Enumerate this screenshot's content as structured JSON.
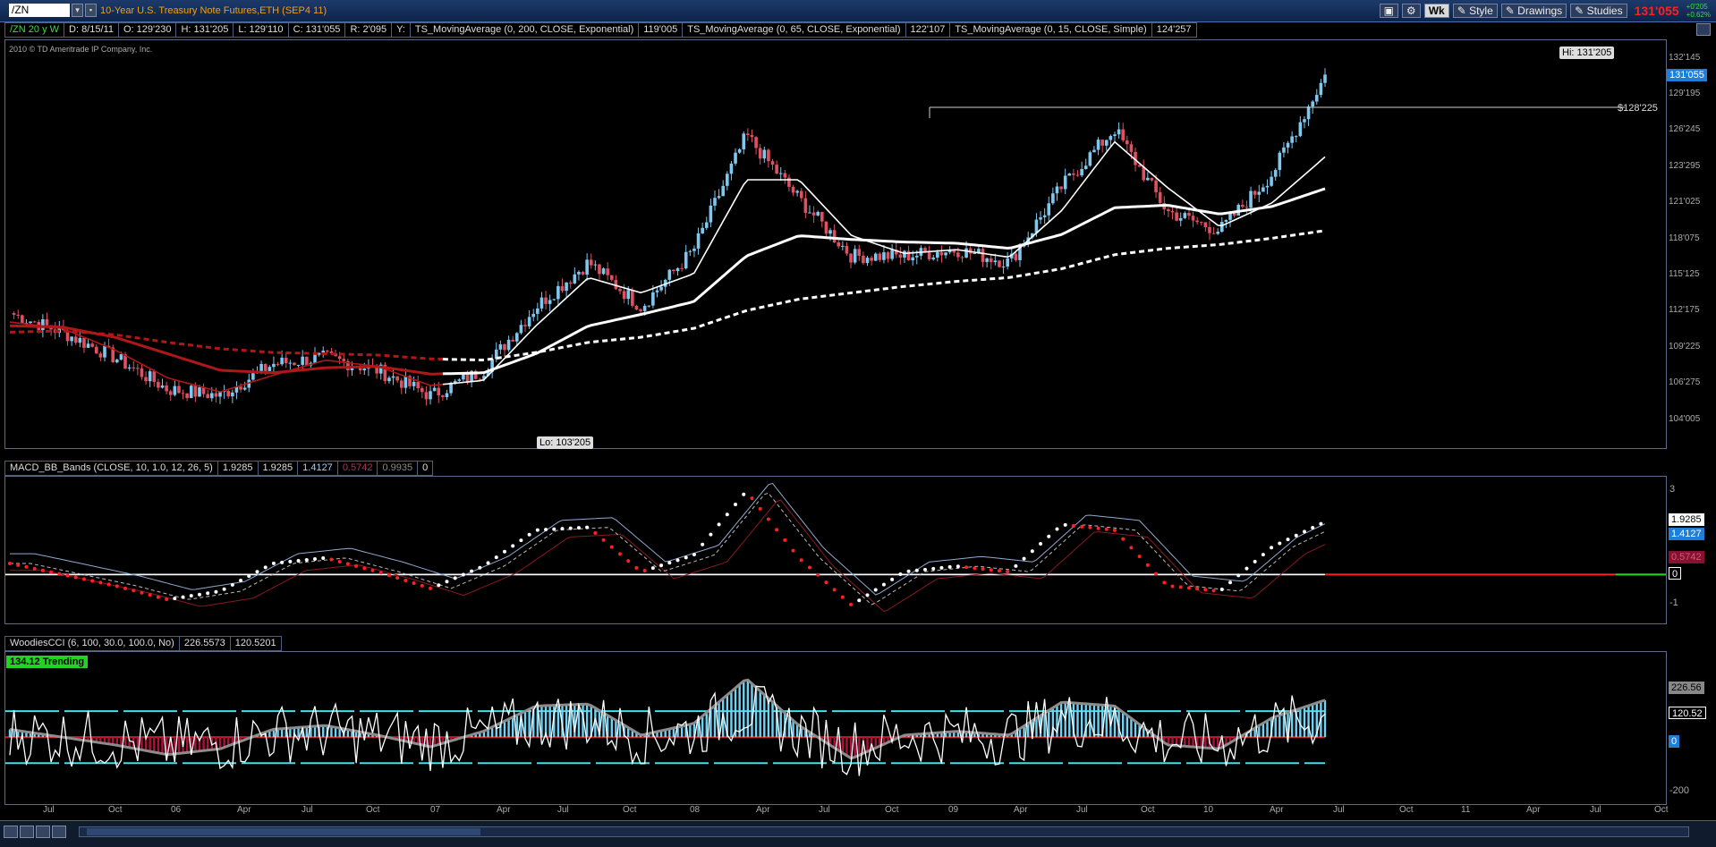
{
  "app": {
    "symbol": "/ZN",
    "symbol_title": "10-Year U.S. Treasury Note Futures,ETH (SEP4 11)",
    "timeframe_button": "Wk",
    "style_label": "Style",
    "drawings_label": "Drawings",
    "studies_label": "Studies",
    "last_price": "131'055",
    "change_up": "+0'205",
    "change_pct": "+0.62%",
    "copyright": "2010 © TD Ameritrade IP Company, Inc."
  },
  "infobar": {
    "symbol_tf": "/ZN 20 y W",
    "date": "D: 8/15/11",
    "open": "O: 129'230",
    "high": "H: 131'205",
    "low": "L: 129'110",
    "close": "C: 131'055",
    "range": "R: 2'095",
    "y": "Y:",
    "ma1_label": "TS_MovingAverage (0, 200, CLOSE, Exponential)",
    "ma1_value": "119'005",
    "ma2_label": "TS_MovingAverage (0, 65, CLOSE, Exponential)",
    "ma2_value": "122'107",
    "ma3_label": "TS_MovingAverage (0, 15, CLOSE, Simple)",
    "ma3_value": "124'257"
  },
  "price_axis": {
    "ticks": [
      "132'145",
      "129'195",
      "126'245",
      "123'295",
      "121'025",
      "118'075",
      "115'125",
      "112'175",
      "109'225",
      "106'275",
      "104'005"
    ],
    "last_box": "131'055",
    "hline_label": "$128'225",
    "hi_label": "Hi: 131'205",
    "lo_label": "Lo: 103'205"
  },
  "macd": {
    "header": "MACD_BB_Bands (CLOSE, 10, 1.0, 12, 26, 5)",
    "v1": "1.9285",
    "v2": "1.9285",
    "v3": "1.4127",
    "v4": "0.5742",
    "v5": "0.9935",
    "v6": "0",
    "axis_top": "3",
    "axis_bottom": "-1",
    "box_main": "1.9285",
    "box_upper": "1.4127",
    "box_lower": "0.5742",
    "box_zero": "0"
  },
  "cci": {
    "header": "WoodiesCCI (6, 100, 30.0, 100.0, No)",
    "v1": "226.5573",
    "v2": "120.5201",
    "badge": "134.12 Trending",
    "box_a": "226.56",
    "box_b": "120.52",
    "box_zero": "0",
    "axis_bottom": "-200"
  },
  "x_axis": {
    "labels": [
      "Jul",
      "Oct",
      "06",
      "Apr",
      "Jul",
      "Oct",
      "07",
      "Apr",
      "Jul",
      "Oct",
      "08",
      "Apr",
      "Jul",
      "Oct",
      "09",
      "Apr",
      "Jul",
      "Oct",
      "10",
      "Apr",
      "Jul",
      "Oct",
      "11",
      "Apr",
      "Jul",
      "Oct"
    ]
  },
  "colors": {
    "up_candle": "#7ec8f0",
    "down_candle": "#e05060",
    "ma_white": "#ffffff",
    "ma_red": "#b01818",
    "cci_up": "#6fd3f5",
    "cci_down": "#b0103a"
  },
  "chart_data": {
    "type": "line",
    "title": "10-Year U.S. Treasury Note Futures,ETH (SEP4 11)",
    "xlabel": "",
    "ylabel": "",
    "ylim": [
      103,
      133
    ],
    "x": [
      "2005-06",
      "2005-10",
      "2006-01",
      "2006-04",
      "2006-07",
      "2006-10",
      "2007-01",
      "2007-04",
      "2007-07",
      "2007-10",
      "2008-01",
      "2008-04",
      "2008-07",
      "2008-10",
      "2009-01",
      "2009-04",
      "2009-07",
      "2009-10",
      "2010-01",
      "2010-04",
      "2010-07",
      "2010-10",
      "2011-01",
      "2011-04",
      "2011-07",
      "2011-08"
    ],
    "series": [
      {
        "name": "Close",
        "values": [
          112.5,
          111.0,
          109.0,
          106.5,
          106.0,
          108.5,
          109.0,
          108.0,
          106.0,
          108.0,
          113.0,
          116.5,
          113.0,
          117.5,
          126.5,
          121.5,
          117.0,
          117.0,
          117.5,
          116.5,
          122.5,
          127.0,
          120.5,
          119.0,
          123.5,
          131.2
        ]
      },
      {
        "name": "TS_MovingAverage (0, 15, CLOSE, Simple)",
        "values": [
          111.8,
          111.3,
          109.6,
          107.4,
          106.3,
          107.6,
          108.8,
          108.3,
          106.8,
          107.2,
          111.5,
          115.3,
          114.1,
          115.6,
          123.0,
          123.0,
          118.6,
          117.2,
          117.5,
          116.9,
          120.6,
          126.0,
          122.4,
          119.3,
          121.2,
          124.8
        ]
      },
      {
        "name": "TS_MovingAverage (0, 65, CLOSE, Exponential)",
        "values": [
          111.5,
          111.4,
          110.6,
          109.3,
          108.0,
          107.8,
          108.2,
          108.3,
          107.7,
          107.8,
          109.3,
          111.5,
          112.4,
          113.4,
          117.0,
          118.6,
          118.3,
          118.1,
          118.0,
          117.6,
          118.7,
          120.8,
          121.0,
          120.3,
          120.9,
          122.3
        ]
      },
      {
        "name": "TS_MovingAverage (0, 200, CLOSE, Exponential)",
        "values": [
          111.0,
          111.1,
          110.8,
          110.2,
          109.7,
          109.4,
          109.3,
          109.2,
          108.9,
          108.8,
          109.4,
          110.2,
          110.6,
          111.3,
          112.7,
          113.6,
          114.1,
          114.6,
          115.0,
          115.3,
          116.0,
          117.1,
          117.6,
          117.9,
          118.4,
          119.0
        ]
      }
    ],
    "annotations": [
      "Hi: 131'205",
      "Lo: 103'205",
      "$128'225"
    ]
  }
}
